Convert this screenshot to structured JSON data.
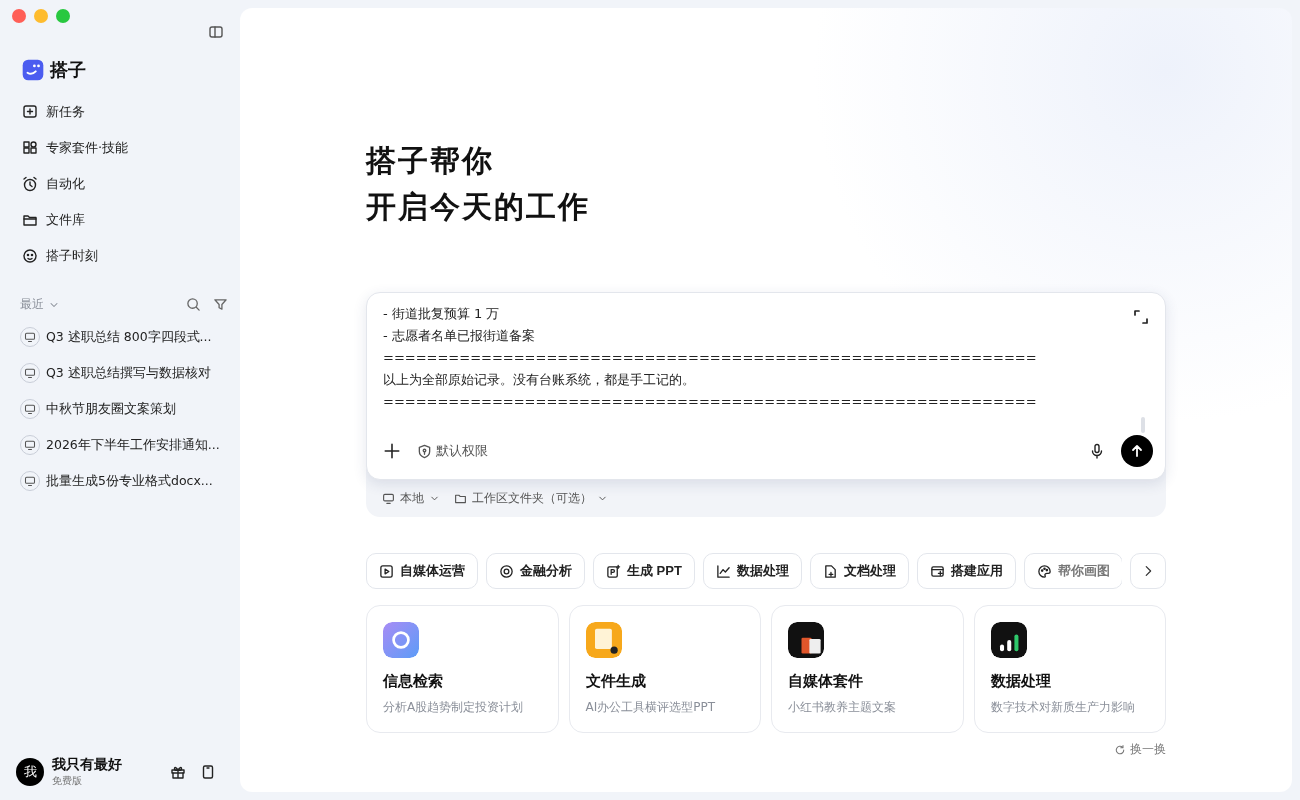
{
  "sidebar": {
    "brand": "搭子",
    "nav": [
      {
        "kind": "new",
        "label": "新任务"
      },
      {
        "kind": "kit",
        "label": "专家套件·技能"
      },
      {
        "kind": "clock",
        "label": "自动化"
      },
      {
        "kind": "folder",
        "label": "文件库"
      },
      {
        "kind": "moment",
        "label": "搭子时刻"
      }
    ],
    "recent_label": "最近",
    "recent": [
      {
        "label": "Q3 述职总结 800字四段式..."
      },
      {
        "label": "Q3 述职总结撰写与数据核对"
      },
      {
        "label": "中秋节朋友圈文案策划"
      },
      {
        "label": "2026年下半年工作安排通知..."
      },
      {
        "label": "批量生成5份专业格式docx..."
      }
    ],
    "user": {
      "avatar": "我",
      "name": "我只有最好",
      "plan": "免费版"
    }
  },
  "main": {
    "headline": [
      "搭子帮你",
      "开启今天的工作"
    ],
    "composer": {
      "lines": [
        "- 街道批复预算 1 万",
        "- 志愿者名单已报街道备案",
        "============================================================",
        "以上为全部原始记录。没有台账系统，都是手工记的。",
        "============================================================"
      ],
      "permission": "默认权限"
    },
    "location": {
      "env": "本地",
      "folder": "工作区文件夹（可选）"
    },
    "chips": [
      {
        "kind": "play",
        "label": "自媒体运营"
      },
      {
        "kind": "target",
        "label": "金融分析"
      },
      {
        "kind": "ppt",
        "label": "生成 PPT"
      },
      {
        "kind": "chart",
        "label": "数据处理"
      },
      {
        "kind": "doc",
        "label": "文档处理"
      },
      {
        "kind": "app",
        "label": "搭建应用"
      },
      {
        "kind": "palette",
        "label": "帮你画图"
      }
    ],
    "cards": [
      {
        "kind": "search",
        "title": "信息检索",
        "subtitle": "分析A股趋势制定投资计划"
      },
      {
        "kind": "file",
        "title": "文件生成",
        "subtitle": "AI办公工具横评选型PPT"
      },
      {
        "kind": "media",
        "title": "自媒体套件",
        "subtitle": "小红书教养主题文案"
      },
      {
        "kind": "data",
        "title": "数据处理",
        "subtitle": "数字技术对新质生产力影响"
      }
    ],
    "refresh": "换一换"
  }
}
